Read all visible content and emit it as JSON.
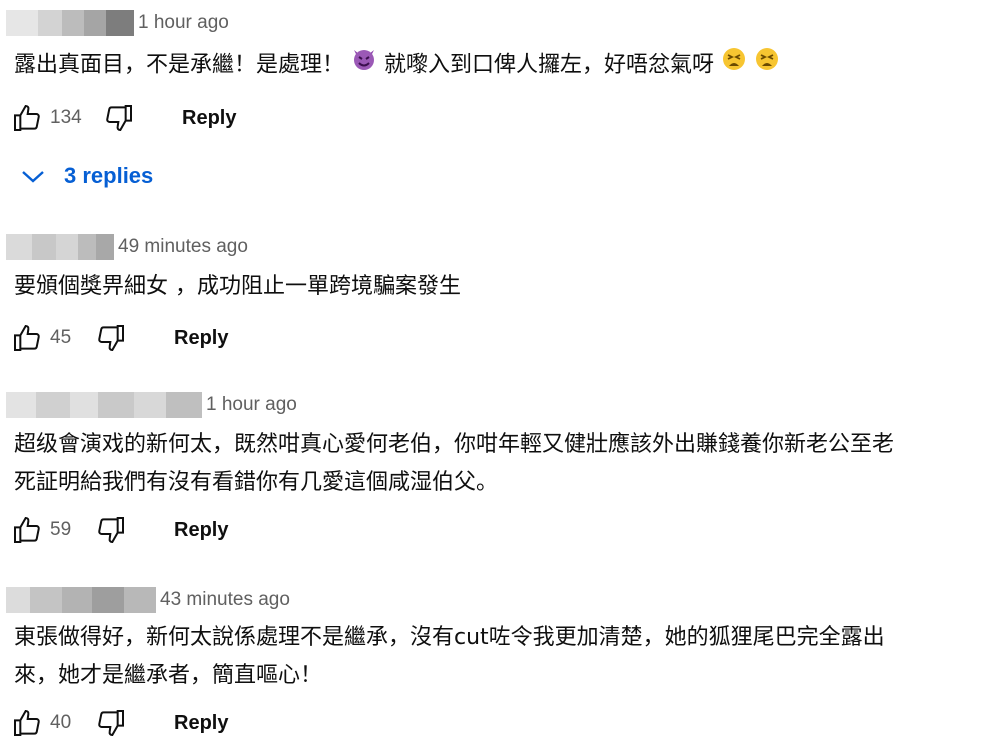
{
  "comments": [
    {
      "time": "1 hour ago",
      "text_a": "露出真面目，不是承繼！是處理！",
      "emoji_a": "smiling-devil-emoji",
      "text_b": " 就嚟入到口俾人攞左，好唔忿氣呀",
      "emoji_b": "tired-face-emoji",
      "likes": "134",
      "reply_label": "Reply"
    },
    {
      "time": "49 minutes ago",
      "text": "要頒個獎畀細女 ，成功阻止一單跨境騙案發生",
      "likes": "45",
      "reply_label": "Reply"
    },
    {
      "time": "1 hour ago",
      "text": "超级會演戏的新何太，既然咁真心愛何老伯，你咁年輕又健壯應該外出賺錢養你新老公至老\n死証明給我們有沒有看錯你有几愛這個咸湿伯父。",
      "likes": "59",
      "reply_label": "Reply"
    },
    {
      "time": "43 minutes ago",
      "text": "東張做得好，新何太說係處理不是繼承，沒有cut咗令我更加清楚，她的狐狸尾巴完全露出\n來，她才是繼承者，簡直嘔心！",
      "likes": "40",
      "reply_label": "Reply"
    }
  ],
  "replies_toggle": {
    "label": "3 replies",
    "icon": "chevron-down-icon"
  },
  "colors": {
    "link": "#065fd4",
    "meta": "#606060",
    "text": "#0f0f0f"
  }
}
